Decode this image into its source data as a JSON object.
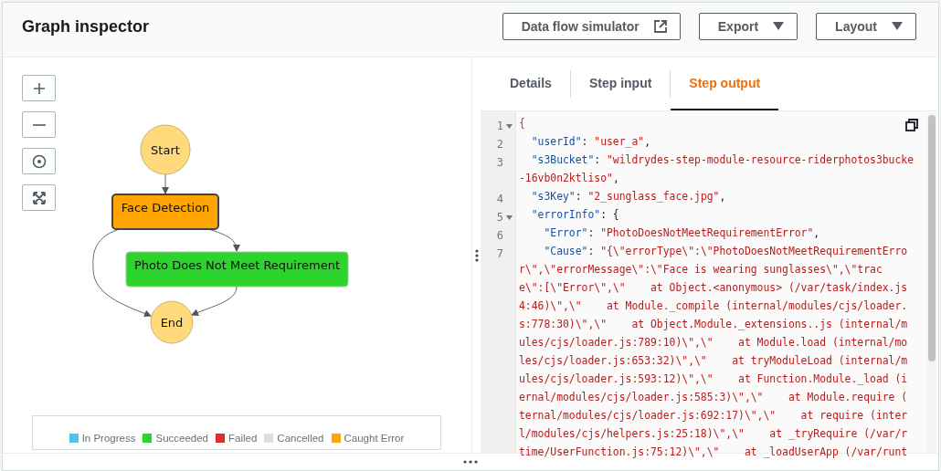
{
  "header": {
    "title": "Graph inspector",
    "buttons": [
      {
        "label": "Data flow simulator",
        "kind": "link"
      },
      {
        "label": "Export",
        "kind": "menu"
      },
      {
        "label": "Layout",
        "kind": "menu"
      }
    ]
  },
  "zoom_controls": [
    {
      "kind": "zoom-in"
    },
    {
      "kind": "zoom-out"
    },
    {
      "kind": "center"
    },
    {
      "kind": "fit"
    }
  ],
  "graph": {
    "nodes": [
      {
        "label": "Start",
        "kind": "terminal",
        "color": "#ffd97a"
      },
      {
        "label": "Face Detection",
        "kind": "task",
        "color": "#ffa500",
        "selected": true
      },
      {
        "label": "Photo Does Not Meet Requirement",
        "kind": "task",
        "color": "#2dd42d",
        "selected": false
      },
      {
        "label": "End",
        "kind": "terminal",
        "color": "#ffd97a"
      }
    ]
  },
  "legend": [
    {
      "label": "In Progress",
      "color": "#4fc3ea"
    },
    {
      "label": "Succeeded",
      "color": "#2dd42d"
    },
    {
      "label": "Failed",
      "color": "#e02d2d"
    },
    {
      "label": "Cancelled",
      "color": "#dddddd"
    },
    {
      "label": "Caught Error",
      "color": "#ffa500"
    }
  ],
  "tabs": [
    {
      "label": "Details",
      "selected": false
    },
    {
      "label": "Step input",
      "selected": false
    },
    {
      "label": "Step output",
      "selected": true
    }
  ],
  "code": [
    {
      "number": "1",
      "foldable": true,
      "segments": [
        {
          "kind": "brace",
          "text": "{"
        }
      ]
    },
    {
      "number": "2",
      "segments": [
        {
          "kind": "key",
          "text": "  \"userId\""
        },
        {
          "kind": "plain",
          "text": ": "
        },
        {
          "kind": "string",
          "text": "\"user_a\""
        },
        {
          "kind": "plain",
          "text": ","
        }
      ]
    },
    {
      "number": "3",
      "segments": [
        {
          "kind": "key",
          "text": "  \"s3Bucket\""
        },
        {
          "kind": "plain",
          "text": ": "
        },
        {
          "kind": "string",
          "text": "\"wildrydes-step-module-resource-riderphotos3bucke"
        }
      ]
    },
    {
      "segments": [
        {
          "kind": "string",
          "text": "-16vb0n2ktliso\""
        },
        {
          "kind": "plain",
          "text": ","
        }
      ]
    },
    {
      "number": "4",
      "segments": [
        {
          "kind": "key",
          "text": "  \"s3Key\""
        },
        {
          "kind": "plain",
          "text": ": "
        },
        {
          "kind": "string",
          "text": "\"2_sunglass_face.jpg\""
        },
        {
          "kind": "plain",
          "text": ","
        }
      ]
    },
    {
      "number": "5",
      "foldable": true,
      "segments": [
        {
          "kind": "key",
          "text": "  \"errorInfo\""
        },
        {
          "kind": "plain",
          "text": ": {"
        }
      ]
    },
    {
      "number": "6",
      "segments": [
        {
          "kind": "key",
          "text": "    \"Error\""
        },
        {
          "kind": "plain",
          "text": ": "
        },
        {
          "kind": "string",
          "text": "\"PhotoDoesNotMeetRequirementError\""
        },
        {
          "kind": "plain",
          "text": ","
        }
      ]
    },
    {
      "number": "7",
      "segments": [
        {
          "kind": "key",
          "text": "    \"Cause\""
        },
        {
          "kind": "plain",
          "text": ": "
        },
        {
          "kind": "string",
          "text": "\"{\\\"errorType\\\":\\\"PhotoDoesNotMeetRequirementErro"
        }
      ]
    },
    {
      "segments": [
        {
          "kind": "string",
          "text": "r\\\",\\\"errorMessage\\\":\\\"Face is wearing sunglasses\\\",\\\"trac"
        }
      ]
    },
    {
      "segments": [
        {
          "kind": "string",
          "text": "e\\\":[\\\"Error\\\",\\\"    at Object.<anonymous> (/var/task/index.js"
        }
      ]
    },
    {
      "segments": [
        {
          "kind": "string",
          "text": "4:46)\\\",\\\"    at Module._compile (internal/modules/cjs/loader."
        }
      ]
    },
    {
      "segments": [
        {
          "kind": "string",
          "text": "s:778:30)\\\",\\\"    at Object.Module._extensions..js (internal/m"
        }
      ]
    },
    {
      "segments": [
        {
          "kind": "string",
          "text": "ules/cjs/loader.js:789:10)\\\",\\\"    at Module.load (internal/mo"
        }
      ]
    },
    {
      "segments": [
        {
          "kind": "string",
          "text": "les/cjs/loader.js:653:32)\\\",\\\"    at tryModuleLoad (internal/m"
        }
      ]
    },
    {
      "segments": [
        {
          "kind": "string",
          "text": "ules/cjs/loader.js:593:12)\\\",\\\"    at Function.Module._load (i"
        }
      ]
    },
    {
      "segments": [
        {
          "kind": "string",
          "text": "ernal/modules/cjs/loader.js:585:3)\\\",\\\"    at Module.require ("
        }
      ]
    },
    {
      "segments": [
        {
          "kind": "string",
          "text": "ternal/modules/cjs/loader.js:692:17)\\\",\\\"    at require (inter"
        }
      ]
    },
    {
      "segments": [
        {
          "kind": "string",
          "text": "l/modules/cjs/helpers.js:25:18)\\\",\\\"    at _tryRequire (/var/r"
        }
      ]
    },
    {
      "segments": [
        {
          "kind": "string",
          "text": "time/UserFunction.js:75:12)\\\",\\\"    at _loadUserApp (/var/runt"
        }
      ]
    }
  ]
}
